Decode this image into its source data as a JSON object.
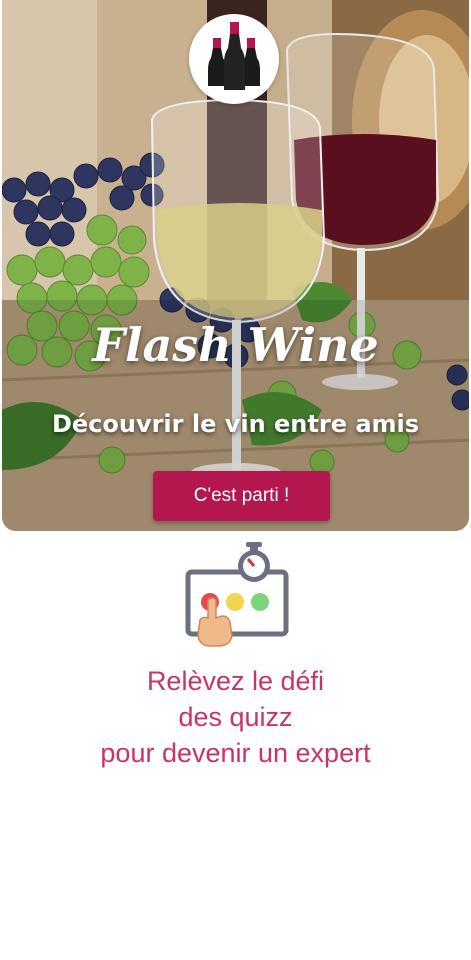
{
  "hero": {
    "brand_title": "Flash Wine",
    "tagline": "Découvrir le vin entre amis",
    "cta_label": "C'est parti !"
  },
  "logo": {
    "icon": "wine-bottles-icon"
  },
  "feature": {
    "icon": "quiz-buzzer-stopwatch-icon",
    "lines": [
      "Relèvez le défi",
      "des quizz",
      "pour devenir un expert"
    ]
  },
  "colors": {
    "accent": "#b3174d",
    "promo_text": "#c8336b",
    "background": "#ffffff"
  }
}
